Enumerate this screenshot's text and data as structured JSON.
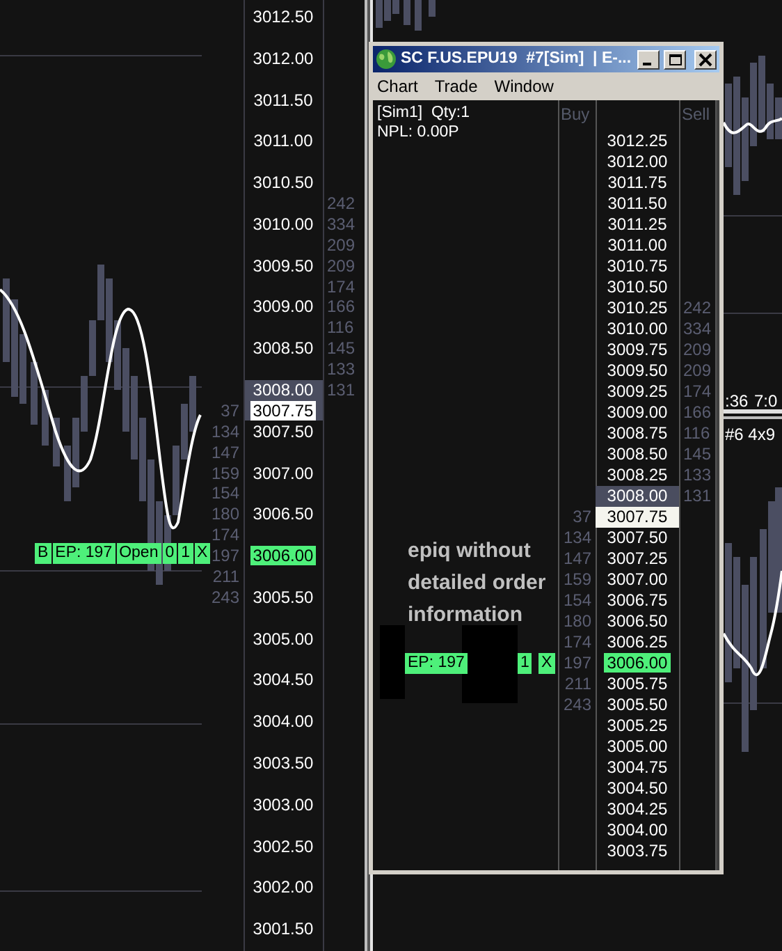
{
  "left_chart": {
    "order_bar": {
      "side": "B",
      "entry": "EP: 197",
      "status": "Open",
      "filled": "0",
      "quantity": "1",
      "cancel": "X"
    }
  },
  "price_axis": {
    "rows": [
      {
        "kind": "plain",
        "price": "3012.50"
      },
      {
        "kind": "plain"
      },
      {
        "kind": "plain",
        "price": "3012.00"
      },
      {
        "kind": "plain"
      },
      {
        "kind": "plain",
        "price": "3011.50"
      },
      {
        "kind": "plain"
      },
      {
        "kind": "plain",
        "price": "3011.00"
      },
      {
        "kind": "plain"
      },
      {
        "kind": "plain",
        "price": "3010.50"
      },
      {
        "kind": "plain",
        "right_size": "242"
      },
      {
        "kind": "plain",
        "price": "3010.00",
        "right_size": "334"
      },
      {
        "kind": "plain",
        "right_size": "209"
      },
      {
        "kind": "plain",
        "price": "3009.50",
        "right_size": "209"
      },
      {
        "kind": "plain",
        "right_size": "174"
      },
      {
        "kind": "plain",
        "price": "3009.00",
        "right_size": "166"
      },
      {
        "kind": "plain",
        "right_size": "116"
      },
      {
        "kind": "plain",
        "price": "3008.50",
        "right_size": "145"
      },
      {
        "kind": "plain",
        "right_size": "133"
      },
      {
        "kind": "bid",
        "price": "3008.00",
        "right_size": "131"
      },
      {
        "kind": "last",
        "price": "3007.75",
        "left_size": "37"
      },
      {
        "kind": "plain",
        "price": "3007.50",
        "left_size": "134"
      },
      {
        "kind": "plain",
        "left_size": "147"
      },
      {
        "kind": "plain",
        "price": "3007.00",
        "left_size": "159"
      },
      {
        "kind": "plain",
        "left_size": "154"
      },
      {
        "kind": "plain",
        "price": "3006.50",
        "left_size": "180"
      },
      {
        "kind": "plain",
        "left_size": "174"
      },
      {
        "kind": "order",
        "price": "3006.00",
        "left_size": "197"
      },
      {
        "kind": "plain",
        "left_size": "211"
      },
      {
        "kind": "plain",
        "price": "3005.50",
        "left_size": "243"
      },
      {
        "kind": "plain"
      },
      {
        "kind": "plain",
        "price": "3005.00"
      },
      {
        "kind": "plain"
      },
      {
        "kind": "plain",
        "price": "3004.50"
      },
      {
        "kind": "plain"
      },
      {
        "kind": "plain",
        "price": "3004.00"
      },
      {
        "kind": "plain"
      },
      {
        "kind": "plain",
        "price": "3003.50"
      },
      {
        "kind": "plain"
      },
      {
        "kind": "plain",
        "price": "3003.00"
      },
      {
        "kind": "plain"
      },
      {
        "kind": "plain",
        "price": "3002.50"
      },
      {
        "kind": "plain"
      },
      {
        "kind": "plain",
        "price": "3002.00"
      },
      {
        "kind": "plain"
      },
      {
        "kind": "plain",
        "price": "3001.50"
      }
    ]
  },
  "right_chart": {
    "time_labels": [
      ":36",
      "7:0"
    ],
    "chart_label": "#6 4x9"
  },
  "dom_window": {
    "title": "SC F.US.EPU19  #7[Sim]  | E-...",
    "menu": [
      "Chart",
      "Trade",
      "Window"
    ],
    "account": "[Sim1]",
    "quantity": "Qty:1",
    "pnl": "NPL: 0.00P",
    "annotation": "epiq without detailed order information",
    "order_bar": {
      "entry": "EP: 197",
      "quantity": "1",
      "cancel": "X"
    },
    "buy_header": "Buy",
    "sell_header": "Sell",
    "rows": [
      {
        "kind": "plain",
        "price": "3012.25"
      },
      {
        "kind": "plain",
        "price": "3012.00"
      },
      {
        "kind": "plain",
        "price": "3011.75"
      },
      {
        "kind": "plain",
        "price": "3011.50"
      },
      {
        "kind": "plain",
        "price": "3011.25"
      },
      {
        "kind": "plain",
        "price": "3011.00"
      },
      {
        "kind": "plain",
        "price": "3010.75"
      },
      {
        "kind": "plain",
        "price": "3010.50"
      },
      {
        "kind": "plain",
        "price": "3010.25",
        "sell": "242"
      },
      {
        "kind": "plain",
        "price": "3010.00",
        "sell": "334"
      },
      {
        "kind": "plain",
        "price": "3009.75",
        "sell": "209"
      },
      {
        "kind": "plain",
        "price": "3009.50",
        "sell": "209"
      },
      {
        "kind": "plain",
        "price": "3009.25",
        "sell": "174"
      },
      {
        "kind": "plain",
        "price": "3009.00",
        "sell": "166"
      },
      {
        "kind": "plain",
        "price": "3008.75",
        "sell": "116"
      },
      {
        "kind": "plain",
        "price": "3008.50",
        "sell": "145"
      },
      {
        "kind": "plain",
        "price": "3008.25",
        "sell": "133"
      },
      {
        "kind": "bid",
        "price": "3008.00",
        "sell": "131"
      },
      {
        "kind": "last",
        "price": "3007.75",
        "buy": "37"
      },
      {
        "kind": "plain",
        "price": "3007.50",
        "buy": "134"
      },
      {
        "kind": "plain",
        "price": "3007.25",
        "buy": "147"
      },
      {
        "kind": "plain",
        "price": "3007.00",
        "buy": "159"
      },
      {
        "kind": "plain",
        "price": "3006.75",
        "buy": "154"
      },
      {
        "kind": "plain",
        "price": "3006.50",
        "buy": "180"
      },
      {
        "kind": "plain",
        "price": "3006.25",
        "buy": "174"
      },
      {
        "kind": "order",
        "price": "3006.00",
        "buy": "197"
      },
      {
        "kind": "plain",
        "price": "3005.75",
        "buy": "211"
      },
      {
        "kind": "plain",
        "price": "3005.50",
        "buy": "243"
      },
      {
        "kind": "plain",
        "price": "3005.25"
      },
      {
        "kind": "plain",
        "price": "3005.00"
      },
      {
        "kind": "plain",
        "price": "3004.75"
      },
      {
        "kind": "plain",
        "price": "3004.50"
      },
      {
        "kind": "plain",
        "price": "3004.25"
      },
      {
        "kind": "plain",
        "price": "3004.00"
      },
      {
        "kind": "plain",
        "price": "3003.75"
      }
    ]
  }
}
